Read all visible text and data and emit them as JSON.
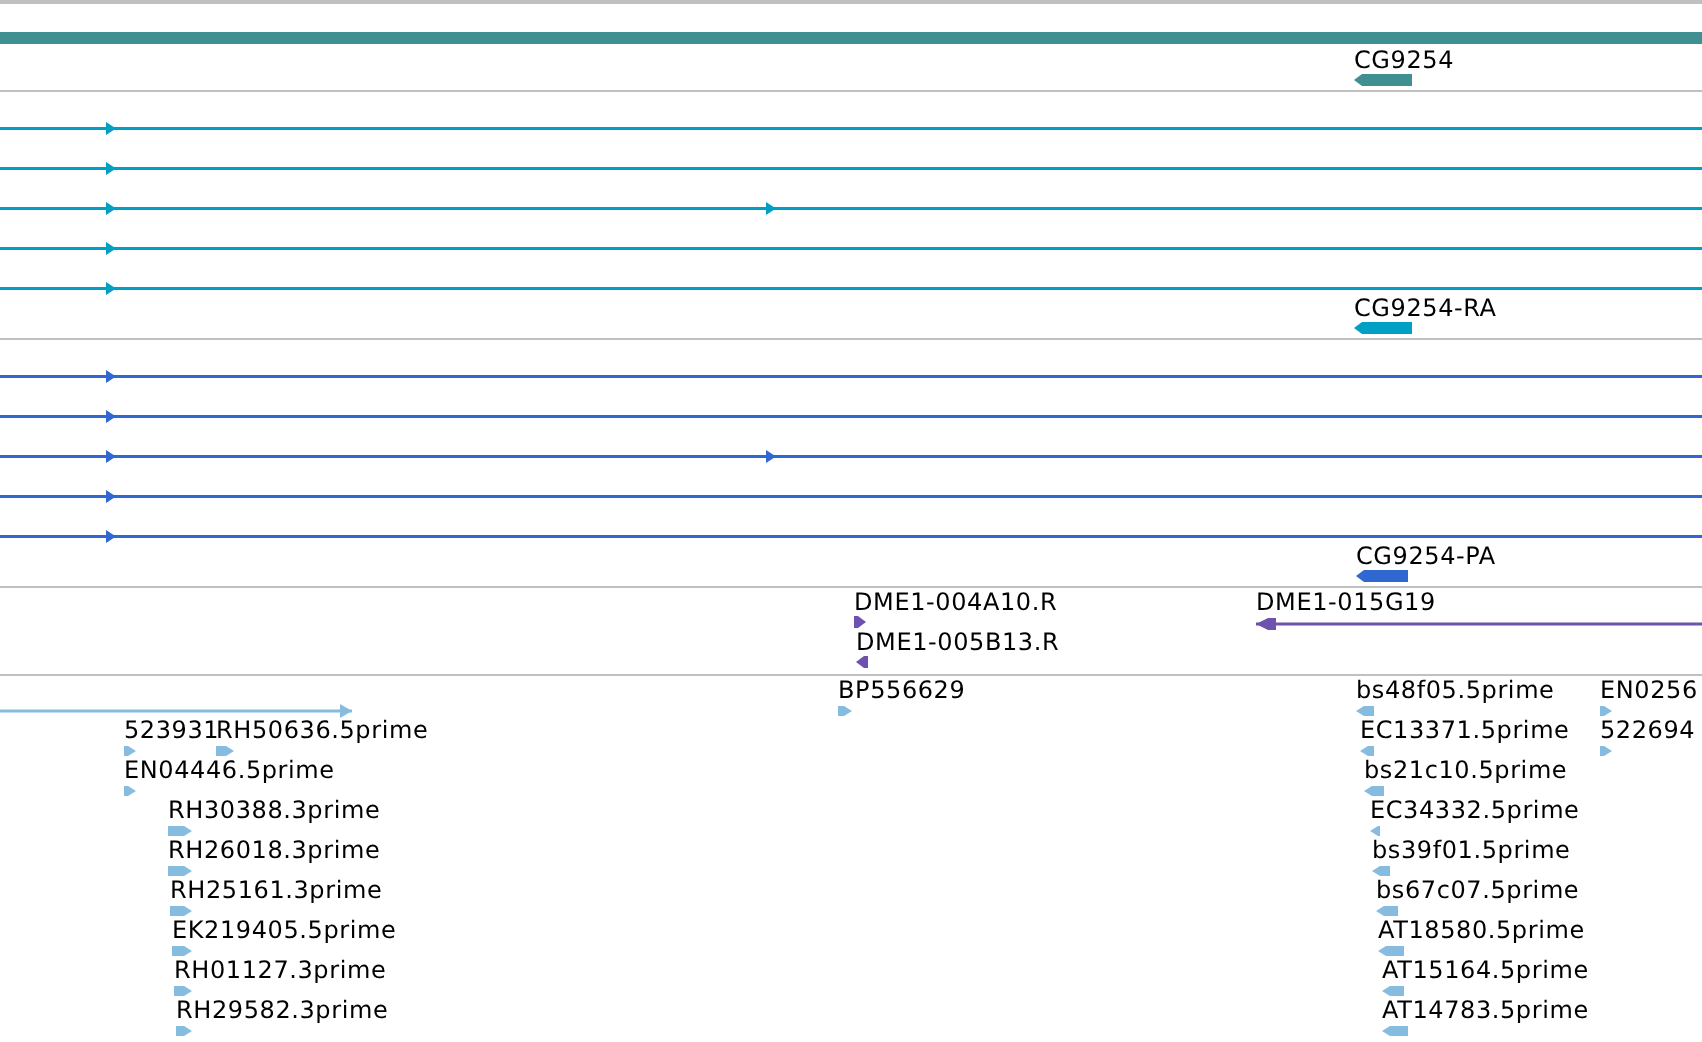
{
  "tracks": [
    {
      "kind": "gene",
      "color": "#408f91",
      "features": [
        {
          "label": "CG9254",
          "reverse": true
        }
      ]
    },
    {
      "kind": "transcript",
      "color": "#00a0c4",
      "features": [
        {
          "label": "CG9254-RA",
          "reverse": true
        }
      ]
    },
    {
      "kind": "protein",
      "color": "#2f68d2",
      "features": [
        {
          "label": "CG9254-PA",
          "reverse": true
        }
      ]
    },
    {
      "kind": "clone",
      "color": "#6f52ae",
      "features": [
        {
          "label": "DME1-004A10.R",
          "reverse": false
        },
        {
          "label": "DME1-005B13.R",
          "reverse": true
        },
        {
          "label": "DME1-015G19",
          "reverse": true
        }
      ]
    },
    {
      "kind": "est",
      "color": "#86bce0",
      "features": [
        {
          "reverse": false
        },
        {
          "label": "523931",
          "reverse": false
        },
        {
          "label": "RH50636.5prime",
          "reverse": false
        },
        {
          "label": "EN04446.5prime",
          "reverse": false
        },
        {
          "label": "RH30388.3prime",
          "reverse": false
        },
        {
          "label": "RH26018.3prime",
          "reverse": false
        },
        {
          "label": "RH25161.3prime",
          "reverse": false
        },
        {
          "label": "EK219405.5prime",
          "reverse": false
        },
        {
          "label": "RH01127.3prime",
          "reverse": false
        },
        {
          "label": "RH29582.3prime",
          "reverse": false
        },
        {
          "label": "BP556629",
          "reverse": false
        },
        {
          "label": "bs48f05.5prime",
          "reverse": true
        },
        {
          "label": "EC13371.5prime",
          "reverse": true
        },
        {
          "label": "bs21c10.5prime",
          "reverse": true
        },
        {
          "label": "EC34332.5prime",
          "reverse": true
        },
        {
          "label": "bs39f01.5prime",
          "reverse": true
        },
        {
          "label": "bs67c07.5prime",
          "reverse": true
        },
        {
          "label": "AT18580.5prime",
          "reverse": true
        },
        {
          "label": "AT15164.5prime",
          "reverse": true
        },
        {
          "label": "AT14783.5prime",
          "reverse": true
        },
        {
          "label": "EN0256",
          "reverse": false
        },
        {
          "label": "522694",
          "reverse": false
        }
      ]
    }
  ]
}
